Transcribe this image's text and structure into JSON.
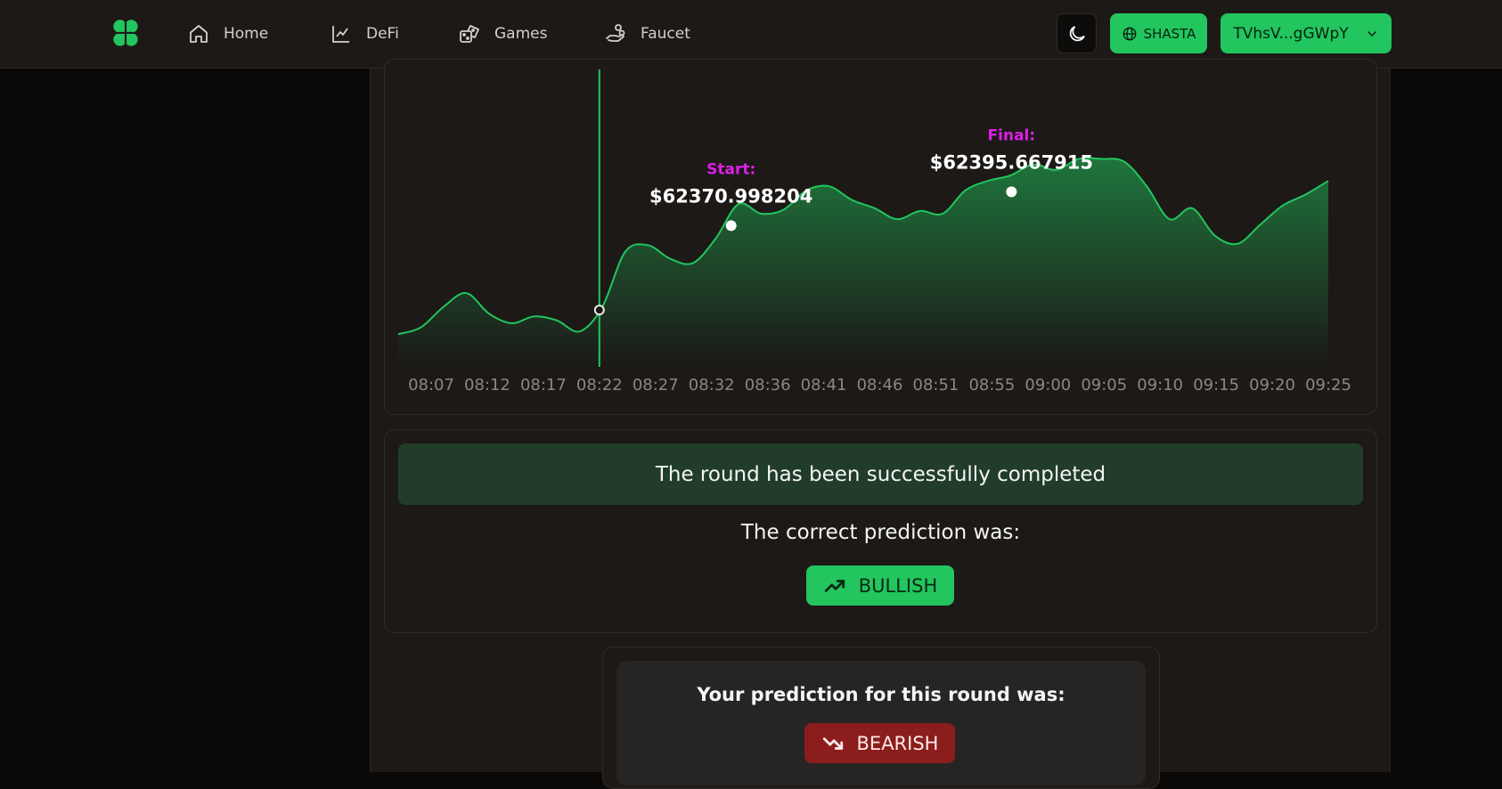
{
  "nav": {
    "items": [
      {
        "label": "Home",
        "icon": "home-icon"
      },
      {
        "label": "DeFi",
        "icon": "chart-line-icon"
      },
      {
        "label": "Games",
        "icon": "dice-icon"
      },
      {
        "label": "Faucet",
        "icon": "hand-coins-icon"
      }
    ],
    "network_label": "SHASTA",
    "wallet_label": "TVhsV...gGWpY",
    "theme_icon": "moon-icon",
    "logo_icon": "clover-icon"
  },
  "colors": {
    "accent": "#22c55e",
    "marker_label": "#e11de8",
    "bearish": "#8b1d1d",
    "banner": "#213d2a"
  },
  "chart_data": {
    "type": "area",
    "x": [
      "08:07",
      "08:12",
      "08:17",
      "08:22",
      "08:27",
      "08:32",
      "08:36",
      "08:41",
      "08:46",
      "08:51",
      "08:55",
      "09:00",
      "09:05",
      "09:10",
      "09:15",
      "09:20",
      "09:25"
    ],
    "y_values": [
      62280,
      62285,
      62300,
      62310,
      62295,
      62288,
      62293,
      62290,
      62282,
      62300,
      62340,
      62345,
      62335,
      62332,
      62350,
      62375,
      62368,
      62371,
      62385,
      62388,
      62378,
      62372,
      62364,
      62370,
      62368,
      62385,
      62392,
      62396,
      62404,
      62400,
      62408,
      62408,
      62406,
      62388,
      62364,
      62372,
      62352,
      62346,
      62360,
      62374,
      62382,
      62392
    ],
    "vertical_marker_label": "08:22",
    "start": {
      "label": "Start:",
      "value": "$62370.998204",
      "price": 62370.998204,
      "time": "08:32"
    },
    "final": {
      "label": "Final:",
      "value": "$62395.667915",
      "price": 62395.667915,
      "time": "08:55"
    },
    "grid": false,
    "legend": "none"
  },
  "result": {
    "banner": "The round has been successfully completed",
    "correct_label": "The correct prediction was:",
    "correct_value": "BULLISH",
    "your_label": "Your prediction for this round was:",
    "your_value": "BEARISH"
  }
}
